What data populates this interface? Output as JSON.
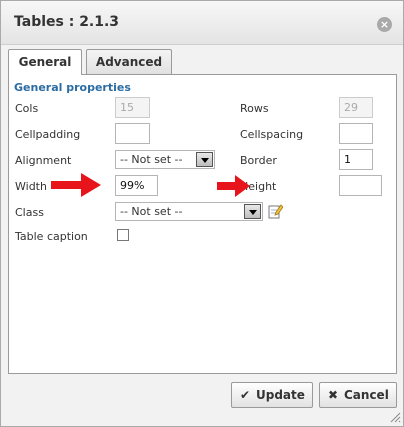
{
  "dialog": {
    "title": "Tables : 2.1.3"
  },
  "tabs": [
    {
      "label": "General",
      "active": true
    },
    {
      "label": "Advanced",
      "active": false
    }
  ],
  "general": {
    "section_title": "General properties",
    "cols": {
      "label": "Cols",
      "value": "15"
    },
    "rows": {
      "label": "Rows",
      "value": "29"
    },
    "cellpadding": {
      "label": "Cellpadding",
      "value": ""
    },
    "cellspacing": {
      "label": "Cellspacing",
      "value": ""
    },
    "alignment": {
      "label": "Alignment",
      "selected": "-- Not set --"
    },
    "border": {
      "label": "Border",
      "value": "1"
    },
    "width": {
      "label": "Width",
      "value": "99%"
    },
    "height": {
      "label": "Height",
      "value": ""
    },
    "class": {
      "label": "Class",
      "selected": "-- Not set --"
    },
    "caption": {
      "label": "Table caption",
      "checked": false
    }
  },
  "buttons": {
    "update": "Update",
    "cancel": "Cancel"
  },
  "colors": {
    "accent": "#2b6ca3",
    "annotation_arrow": "#e8141b"
  }
}
